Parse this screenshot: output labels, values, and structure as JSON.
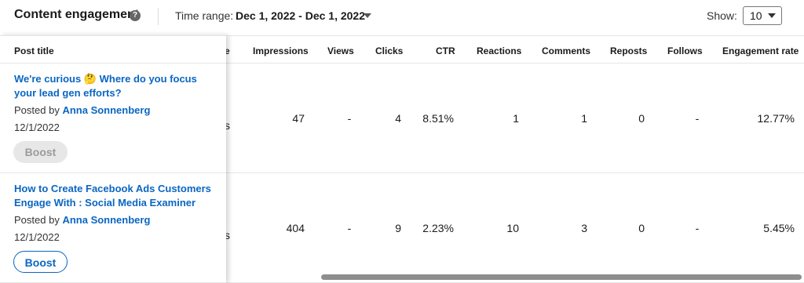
{
  "header": {
    "title": "Content engagement",
    "help_icon": "?",
    "time_range_label": "Time range:",
    "time_range_value": "Dec 1, 2022 - Dec 1, 2022",
    "show_label": "Show:",
    "show_value": "10"
  },
  "table": {
    "columns": {
      "post_title": "Post title",
      "partial": "e",
      "impressions": "Impressions",
      "views": "Views",
      "clicks": "Clicks",
      "ctr": "CTR",
      "reactions": "Reactions",
      "comments": "Comments",
      "reposts": "Reposts",
      "follows": "Follows",
      "engagement_rate": "Engagement rate"
    },
    "rows": [
      {
        "title": "We're curious 🤔 Where do you focus your lead gen efforts?",
        "posted_by_label": "Posted by",
        "author": "Anna Sonnenberg",
        "date": "12/1/2022",
        "boost": "Boost",
        "boost_enabled": false,
        "partial": "s",
        "impressions": "47",
        "views": "-",
        "clicks": "4",
        "ctr": "8.51%",
        "reactions": "1",
        "comments": "1",
        "reposts": "0",
        "follows": "-",
        "engagement_rate": "12.77%"
      },
      {
        "title": "How to Create Facebook Ads Customers Engage With : Social Media Examiner",
        "posted_by_label": "Posted by",
        "author": "Anna Sonnenberg",
        "date": "12/1/2022",
        "boost": "Boost",
        "boost_enabled": true,
        "partial": "s",
        "impressions": "404",
        "views": "-",
        "clicks": "9",
        "ctr": "2.23%",
        "reactions": "10",
        "comments": "3",
        "reposts": "0",
        "follows": "-",
        "engagement_rate": "5.45%"
      }
    ]
  },
  "colors": {
    "link": "#0a66c2",
    "text": "#1a1a1a",
    "boost_disabled_bg": "#e7e7e7"
  }
}
